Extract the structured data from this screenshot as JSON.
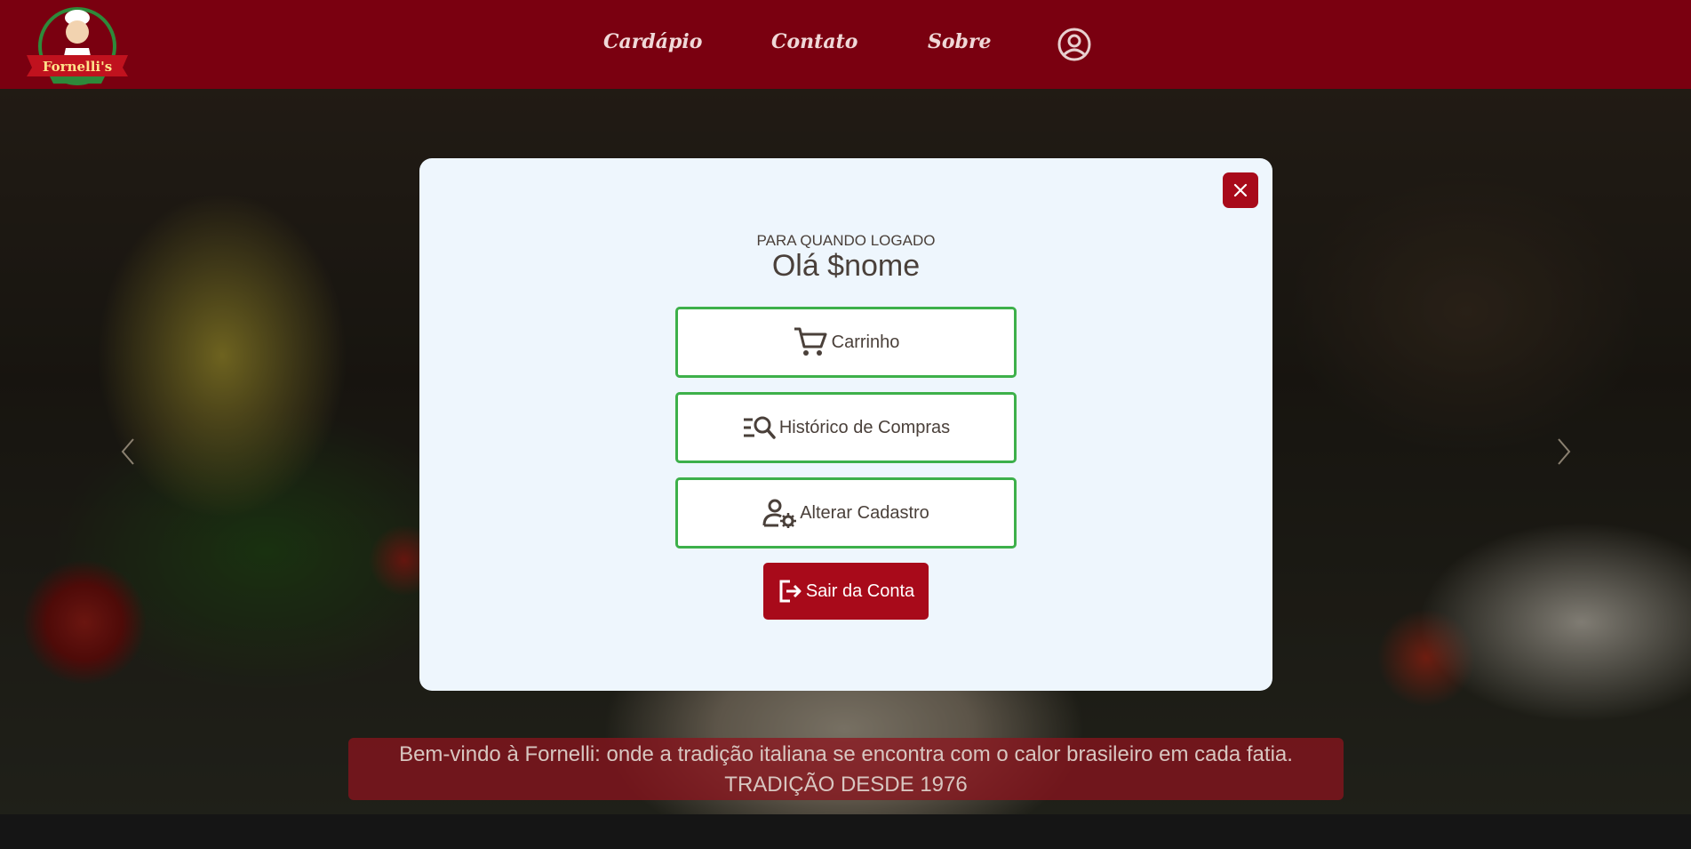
{
  "header": {
    "logo_text": "Fornelli's",
    "nav": [
      {
        "label": "Cardápio"
      },
      {
        "label": "Contato"
      },
      {
        "label": "Sobre"
      }
    ],
    "user_icon": "user-circle-icon"
  },
  "hero": {
    "banner_line1": "Bem-vindo à Fornelli: onde a tradição italiana se encontra com o calor brasileiro em cada fatia.",
    "banner_line2": "TRADIÇÃO DESDE 1976"
  },
  "modal": {
    "subtitle": "PARA QUANDO LOGADO",
    "title": "Olá $nome",
    "buttons": [
      {
        "label": "Carrinho",
        "icon": "cart-icon"
      },
      {
        "label": "Histórico de Compras",
        "icon": "list-search-icon"
      },
      {
        "label": "Alterar Cadastro",
        "icon": "user-settings-icon"
      }
    ],
    "logout_label": "Sair da Conta",
    "close_icon": "close-icon"
  },
  "colors": {
    "header_bg": "#7a0010",
    "accent_red": "#a80a1a",
    "button_border_green": "#3db04a",
    "modal_bg": "#eef6fd"
  }
}
